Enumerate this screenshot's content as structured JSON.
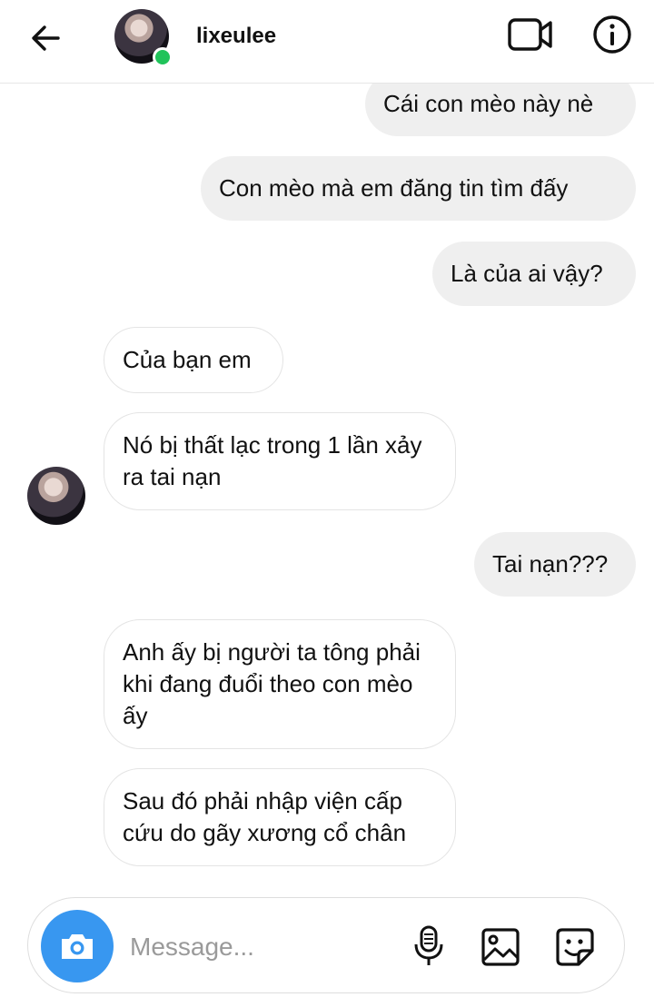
{
  "header": {
    "username": "lixeulee",
    "online": true,
    "icons": {
      "back": "arrow-left-icon",
      "video": "video-camera-icon",
      "info": "info-icon"
    }
  },
  "messages": [
    {
      "side": "sent",
      "text": "Cái con mèo này nè"
    },
    {
      "side": "sent",
      "text": "Con mèo mà em đăng tin tìm đấy"
    },
    {
      "side": "sent",
      "text": "Là của ai vậy?"
    },
    {
      "side": "received",
      "text": "Của bạn em"
    },
    {
      "side": "received",
      "text": "Nó bị thất lạc trong 1 lần xảy ra tai nạn"
    },
    {
      "side": "sent",
      "text": "Tai nạn???"
    },
    {
      "side": "received",
      "text": "Anh ấy bị người ta tông phải khi đang đuổi theo con mèo ấy"
    },
    {
      "side": "received",
      "text": "Sau đó phải nhập viện cấp cứu do gãy xương cổ chân"
    }
  ],
  "composer": {
    "placeholder": "Message...",
    "icons": {
      "camera": "camera-icon",
      "mic": "microphone-icon",
      "gallery": "gallery-icon",
      "sticker": "sticker-icon"
    },
    "accent_color": "#3897f0"
  }
}
